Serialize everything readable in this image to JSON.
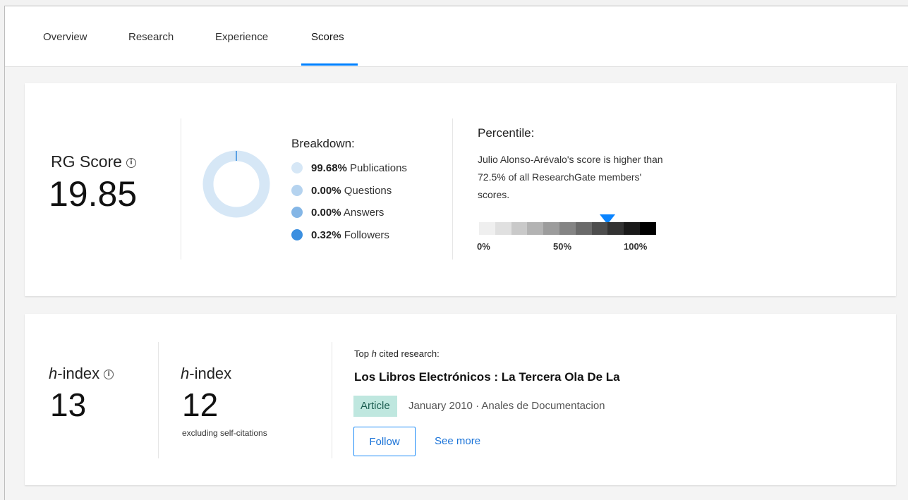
{
  "tabs": [
    {
      "label": "Overview"
    },
    {
      "label": "Research"
    },
    {
      "label": "Experience"
    },
    {
      "label": "Scores",
      "active": true
    }
  ],
  "rg_score": {
    "label": "RG Score",
    "info_icon": "info-icon",
    "value": "19.85"
  },
  "breakdown": {
    "title": "Breakdown:",
    "items": [
      {
        "pct": "99.68%",
        "label": "Publications",
        "color": "#d6e7f6",
        "share": 99.68
      },
      {
        "pct": "0.00%",
        "label": "Questions",
        "color": "#b5d3ef",
        "share": 0.0
      },
      {
        "pct": "0.00%",
        "label": "Answers",
        "color": "#84b6e6",
        "share": 0.0
      },
      {
        "pct": "0.32%",
        "label": "Followers",
        "color": "#3b8fe0",
        "share": 0.32
      }
    ]
  },
  "percentile": {
    "title": "Percentile:",
    "description": "Julio Alonso-Arévalo's score is higher than 72.5% of all ResearchGate members' scores.",
    "value": 72.5,
    "scale_labels": [
      "0%",
      "50%",
      "100%"
    ],
    "marker_color": "#0a84ff"
  },
  "hindex": {
    "label_italic": "h",
    "label_rest": "-index",
    "value": "13",
    "excl_label_italic": "h",
    "excl_label_rest": "-index",
    "excl_value": "12",
    "excl_sub": "excluding self-citations"
  },
  "top_cited": {
    "heading_pre": "Top ",
    "heading_italic": "h",
    "heading_post": " cited research:",
    "title": "Los Libros Electrónicos : La Tercera Ola De La",
    "type": "Article",
    "meta": "January 2010 · Anales de Documentacion",
    "follow_label": "Follow",
    "see_more_label": "See more"
  }
}
